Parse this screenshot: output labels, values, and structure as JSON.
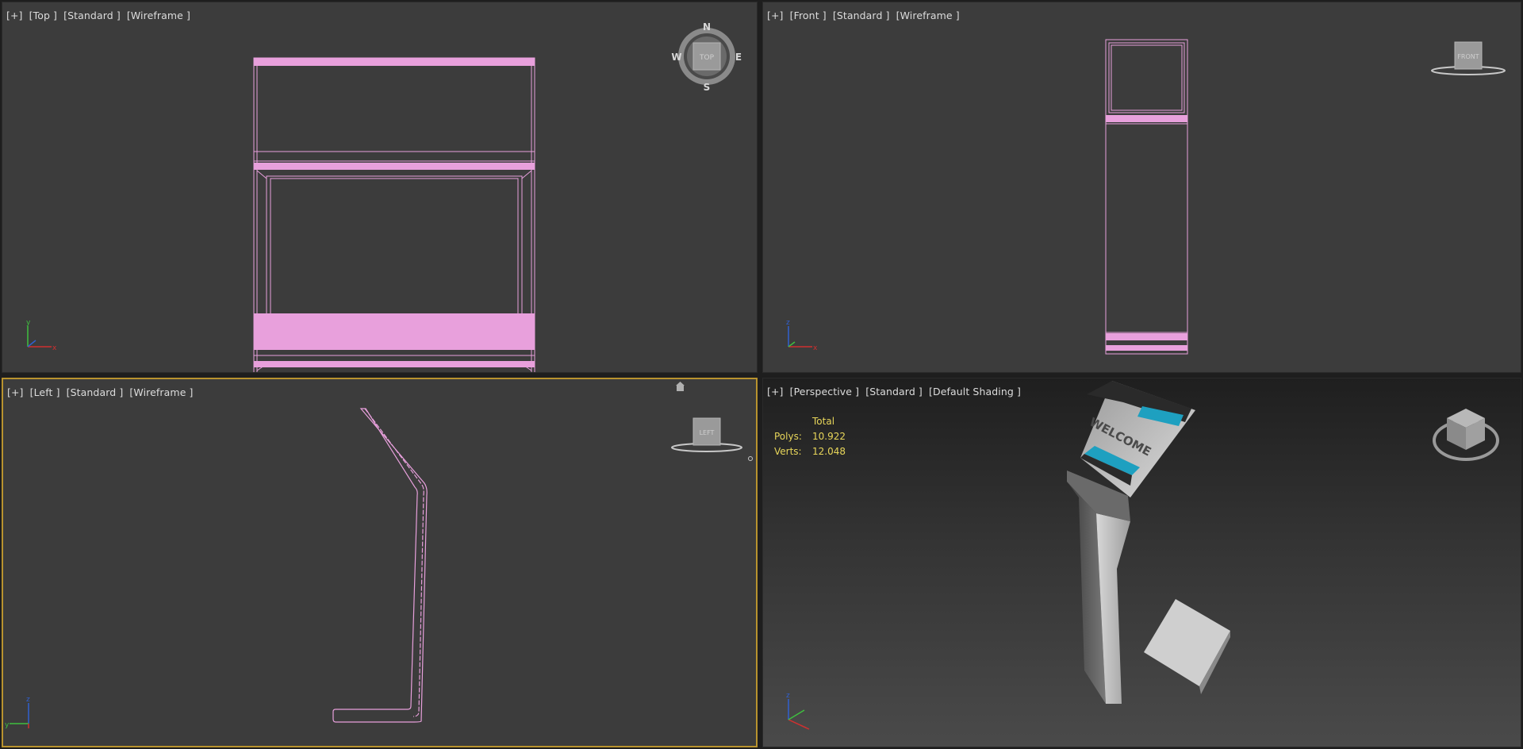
{
  "viewports": {
    "top": {
      "labels": [
        "[+]",
        "[Top ]",
        "[Standard ]",
        "[Wireframe ]"
      ],
      "viewcube": {
        "face": "TOP",
        "compass": {
          "n": "N",
          "s": "S",
          "e": "E",
          "w": "W"
        }
      }
    },
    "front": {
      "labels": [
        "[+]",
        "[Front ]",
        "[Standard ]",
        "[Wireframe ]"
      ],
      "viewcube": {
        "face": "FRONT"
      }
    },
    "left": {
      "labels": [
        "[+]",
        "[Left ]",
        "[Standard ]",
        "[Wireframe ]"
      ],
      "viewcube": {
        "face": "LEFT"
      },
      "active": true
    },
    "perspective": {
      "labels": [
        "[+]",
        "[Perspective ]",
        "[Standard ]",
        "[Default Shading ]"
      ],
      "stats": {
        "header": "Total",
        "polys_label": "Polys:",
        "polys": "10.922",
        "verts_label": "Verts:",
        "verts": "12.048"
      },
      "screen_text": "WELCOME"
    }
  },
  "axis_labels": {
    "x": "x",
    "y": "y",
    "z": "z"
  },
  "colors": {
    "wireframe": "#e8a0dc",
    "viewport_bg": "#3c3c3c",
    "active_border": "#b8932e",
    "stats_text": "#e8d65a",
    "accent_teal": "#1ea0c0"
  }
}
